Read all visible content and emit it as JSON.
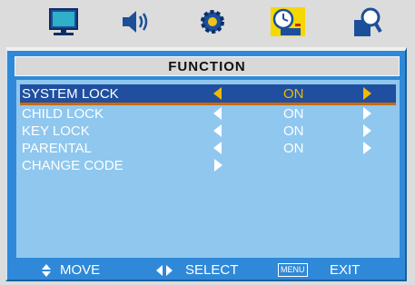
{
  "tabs": [
    {
      "name": "picture",
      "icon": "monitor-icon"
    },
    {
      "name": "sound",
      "icon": "speaker-icon"
    },
    {
      "name": "setup",
      "icon": "gear-icon"
    },
    {
      "name": "function",
      "icon": "clock-icon",
      "selected": true
    },
    {
      "name": "search",
      "icon": "magnifier-icon"
    }
  ],
  "menu": {
    "title": "FUNCTION",
    "rows": [
      {
        "label": "SYSTEM LOCK",
        "value": "ON",
        "selected": true
      },
      {
        "label": "CHILD LOCK",
        "value": "ON"
      },
      {
        "label": "KEY LOCK",
        "value": "ON"
      },
      {
        "label": "PARENTAL",
        "value": "ON"
      },
      {
        "label": "CHANGE CODE"
      }
    ]
  },
  "footer": {
    "move": "MOVE",
    "select": "SELECT",
    "menu_key": "MENU",
    "exit": "EXIT"
  },
  "colors": {
    "panel": "#2f89d8",
    "content": "#8fc7ee",
    "highlight": "#1f4f9e",
    "selected_value": "#f5b800"
  }
}
